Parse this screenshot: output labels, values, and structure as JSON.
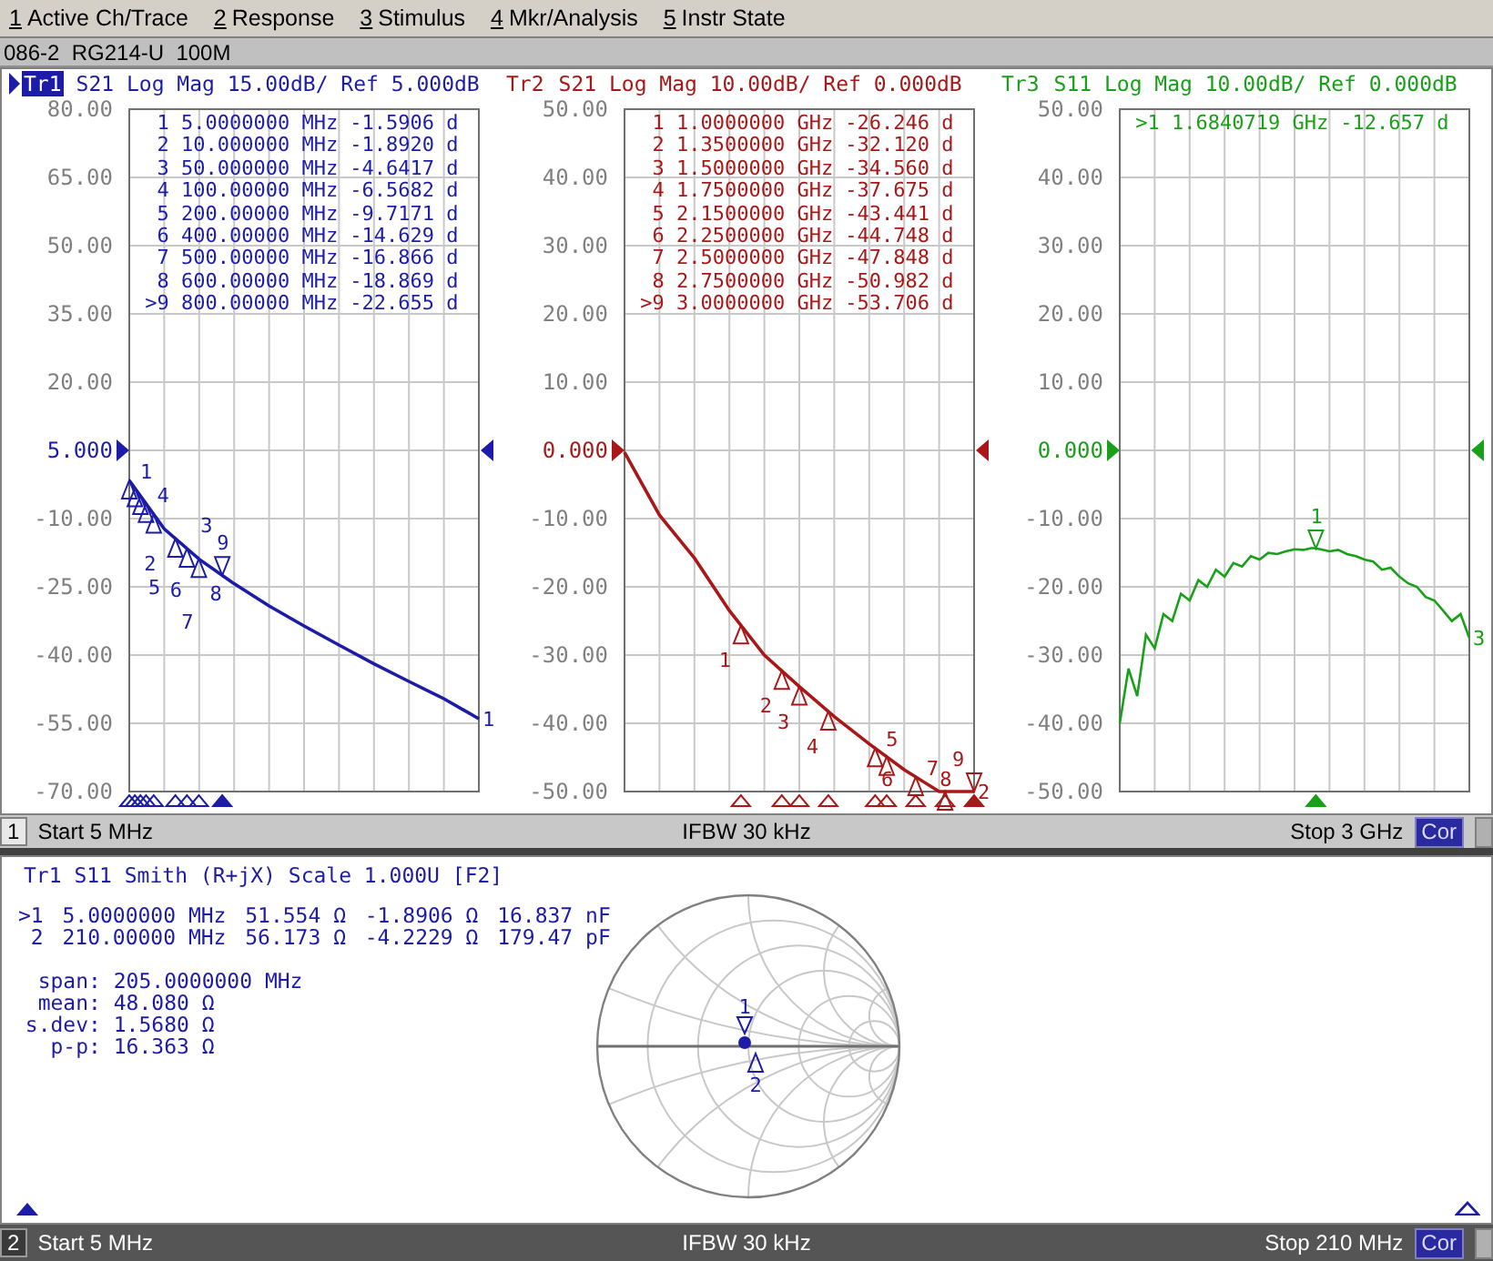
{
  "menu": [
    {
      "key": "1",
      "label": "Active Ch/Trace"
    },
    {
      "key": "2",
      "label": "Response"
    },
    {
      "key": "3",
      "label": "Stimulus"
    },
    {
      "key": "4",
      "label": "Mkr/Analysis"
    },
    {
      "key": "5",
      "label": "Instr State"
    }
  ],
  "window": {
    "title": "086-2  RG214-U  100M"
  },
  "channels": [
    {
      "number": "1",
      "active": true,
      "traces": [
        {
          "name": "Tr1",
          "selected": true,
          "description": "S21 Log Mag 15.00dB/ Ref 5.000dB",
          "color": "#1c1ca8"
        },
        {
          "name": "Tr2",
          "selected": false,
          "description": "S21 Log Mag 10.00dB/ Ref 0.000dB",
          "color": "#a81818"
        },
        {
          "name": "Tr3",
          "selected": false,
          "description": "S11 Log Mag 10.00dB/ Ref 0.000dB",
          "color": "#18a018"
        }
      ],
      "plots": [
        {
          "kind": "smooth",
          "trace_end_label": "1",
          "marker_symbols": [
            "1",
            "2",
            "3",
            "4",
            "5",
            "6",
            "7",
            "8",
            "9"
          ],
          "markers": [
            {
              "label": "1",
              "stimulus": "5.0000000 MHz",
              "response": "-1.5906 d",
              "selected": false
            },
            {
              "label": "2",
              "stimulus": "10.000000 MHz",
              "response": "-1.8920 d",
              "selected": false
            },
            {
              "label": "3",
              "stimulus": "50.000000 MHz",
              "response": "-4.6417 d",
              "selected": false
            },
            {
              "label": "4",
              "stimulus": "100.00000 MHz",
              "response": "-6.5682 d",
              "selected": false
            },
            {
              "label": "5",
              "stimulus": "200.00000 MHz",
              "response": "-9.7171 d",
              "selected": false
            },
            {
              "label": "6",
              "stimulus": "400.00000 MHz",
              "response": "-14.629 d",
              "selected": false
            },
            {
              "label": "7",
              "stimulus": "500.00000 MHz",
              "response": "-16.866 d",
              "selected": false
            },
            {
              "label": "8",
              "stimulus": "600.00000 MHz",
              "response": "-18.869 d",
              "selected": false
            },
            {
              "label": ">9",
              "stimulus": "800.00000 MHz",
              "response": "-22.655 d",
              "selected": true
            }
          ],
          "chart_data": {
            "type": "line",
            "grid": true,
            "categories": [
              null,
              null,
              null,
              null,
              null,
              null,
              null,
              null,
              null,
              null,
              null
            ],
            "ylim": [
              -70,
              80
            ],
            "yticks": [
              {
                "value": -70,
                "label": "-70.00"
              },
              {
                "value": -55,
                "label": "-55.00"
              },
              {
                "value": -40,
                "label": "-40.00"
              },
              {
                "value": -25,
                "label": "-25.00"
              },
              {
                "value": -10,
                "label": "-10.00"
              },
              {
                "value": 5,
                "label": "5.000"
              },
              {
                "value": 20,
                "label": "20.00"
              },
              {
                "value": 35,
                "label": "35.00"
              },
              {
                "value": 50,
                "label": "50.00"
              },
              {
                "value": 65,
                "label": "65.00"
              },
              {
                "value": 80,
                "label": "80.00"
              }
            ],
            "values": [
              -1.6,
              -12.3,
              -18.9,
              -24.3,
              -29.2,
              -33.6,
              -37.8,
              -41.9,
              -45.8,
              -49.6,
              -54
            ]
          }
        },
        {
          "kind": "smooth",
          "trace_end_label": "2",
          "marker_symbols": [
            "1",
            "2",
            "3",
            "4",
            "5",
            "6",
            "7",
            "8",
            "9"
          ],
          "markers": [
            {
              "label": "1",
              "stimulus": "1.0000000 GHz",
              "response": "-26.246 d",
              "selected": false
            },
            {
              "label": "2",
              "stimulus": "1.3500000 GHz",
              "response": "-32.120 d",
              "selected": false
            },
            {
              "label": "3",
              "stimulus": "1.5000000 GHz",
              "response": "-34.560 d",
              "selected": false
            },
            {
              "label": "4",
              "stimulus": "1.7500000 GHz",
              "response": "-37.675 d",
              "selected": false
            },
            {
              "label": "5",
              "stimulus": "2.1500000 GHz",
              "response": "-43.441 d",
              "selected": false
            },
            {
              "label": "6",
              "stimulus": "2.2500000 GHz",
              "response": "-44.748 d",
              "selected": false
            },
            {
              "label": "7",
              "stimulus": "2.5000000 GHz",
              "response": "-47.848 d",
              "selected": false
            },
            {
              "label": "8",
              "stimulus": "2.7500000 GHz",
              "response": "-50.982 d",
              "selected": false
            },
            {
              "label": ">9",
              "stimulus": "3.0000000 GHz",
              "response": "-53.706 d",
              "selected": true
            }
          ],
          "chart_data": {
            "type": "line",
            "grid": true,
            "categories": [
              null,
              null,
              null,
              null,
              null,
              null,
              null,
              null,
              null,
              null,
              null
            ],
            "ylim": [
              -50,
              50
            ],
            "yticks": [
              {
                "value": -50,
                "label": "-50.00"
              },
              {
                "value": -40,
                "label": "-40.00"
              },
              {
                "value": -30,
                "label": "-30.00"
              },
              {
                "value": -20,
                "label": "-20.00"
              },
              {
                "value": -10,
                "label": "-10.00"
              },
              {
                "value": 0,
                "label": "0.000"
              },
              {
                "value": 10,
                "label": "10.00"
              },
              {
                "value": 20,
                "label": "20.00"
              },
              {
                "value": 30,
                "label": "30.00"
              },
              {
                "value": 40,
                "label": "40.00"
              },
              {
                "value": 50,
                "label": "50.00"
              }
            ],
            "values": [
              -0.3,
              -9.5,
              -15.8,
              -23.5,
              -30,
              -34.6,
              -39,
              -43,
              -46.8,
              -50,
              -50
            ]
          }
        },
        {
          "kind": "noisy",
          "trace_end_label": "3",
          "marker_symbols": [
            "1"
          ],
          "markers": [
            {
              "label": ">1",
              "stimulus": "1.6840719 GHz",
              "response": "-12.657 d",
              "selected": true
            }
          ],
          "chart_data": {
            "type": "line",
            "grid": true,
            "categories": [
              null,
              null,
              null,
              null,
              null,
              null,
              null,
              null,
              null,
              null,
              null,
              null,
              null,
              null,
              null,
              null,
              null,
              null,
              null,
              null,
              null,
              null,
              null,
              null,
              null,
              null,
              null,
              null,
              null,
              null,
              null,
              null,
              null,
              null,
              null,
              null,
              null,
              null,
              null,
              null,
              null
            ],
            "ylim": [
              -50,
              50
            ],
            "yticks": [
              {
                "value": -50,
                "label": "-50.00"
              },
              {
                "value": -40,
                "label": "-40.00"
              },
              {
                "value": -30,
                "label": "-30.00"
              },
              {
                "value": -20,
                "label": "-20.00"
              },
              {
                "value": -10,
                "label": "-10.00"
              },
              {
                "value": 0,
                "label": "0.000"
              },
              {
                "value": 10,
                "label": "10.00"
              },
              {
                "value": 20,
                "label": "20.00"
              },
              {
                "value": 30,
                "label": "30.00"
              },
              {
                "value": 40,
                "label": "40.00"
              },
              {
                "value": 50,
                "label": "50.00"
              }
            ],
            "values": [
              -40,
              -32,
              -36,
              -27,
              -29,
              -24,
              -25,
              -21,
              -22,
              -19,
              -20,
              -17.5,
              -18.5,
              -16.5,
              -17,
              -15.5,
              -16,
              -15,
              -15.2,
              -14.8,
              -14.5,
              -14.6,
              -14.3,
              -14.5,
              -14.8,
              -14.6,
              -15.2,
              -15.5,
              -16,
              -16.3,
              -17.5,
              -17.2,
              -18.5,
              -19.5,
              -20,
              -21.5,
              -22,
              -23.5,
              -25,
              -24,
              -27.5
            ]
          }
        }
      ],
      "status": {
        "start": "Start 5 MHz",
        "ifbw": "IFBW 30 kHz",
        "stop": "Stop 3 GHz",
        "correction": "Cor"
      }
    },
    {
      "number": "2",
      "active": false,
      "smith": {
        "title": "Tr1 S11 Smith (R+jX) Scale 1.000U [F2]",
        "color": "#1c1ca8",
        "markers": [
          {
            "label": ">1",
            "stimulus": "5.0000000 MHz",
            "resistance": "51.554 Ω",
            "reactance": "-1.8906 Ω",
            "equivalent": "16.837 nF"
          },
          {
            "label": "2",
            "stimulus": "210.00000 MHz",
            "resistance": "56.173 Ω",
            "reactance": "-4.2229 Ω",
            "equivalent": "179.47 pF"
          }
        ],
        "statistics": [
          {
            "name": "span:",
            "value": "205.0000000 MHz"
          },
          {
            "name": "mean:",
            "value": "48.080 Ω"
          },
          {
            "name": "s.dev:",
            "value": "1.5680 Ω"
          },
          {
            "name": "p-p:",
            "value": "16.363 Ω"
          }
        ],
        "chart_labels": [
          "1",
          "2"
        ]
      },
      "status": {
        "start": "Start 5 MHz",
        "ifbw": "IFBW 30 kHz",
        "stop": "Stop 210 MHz",
        "correction": "Cor"
      }
    }
  ]
}
